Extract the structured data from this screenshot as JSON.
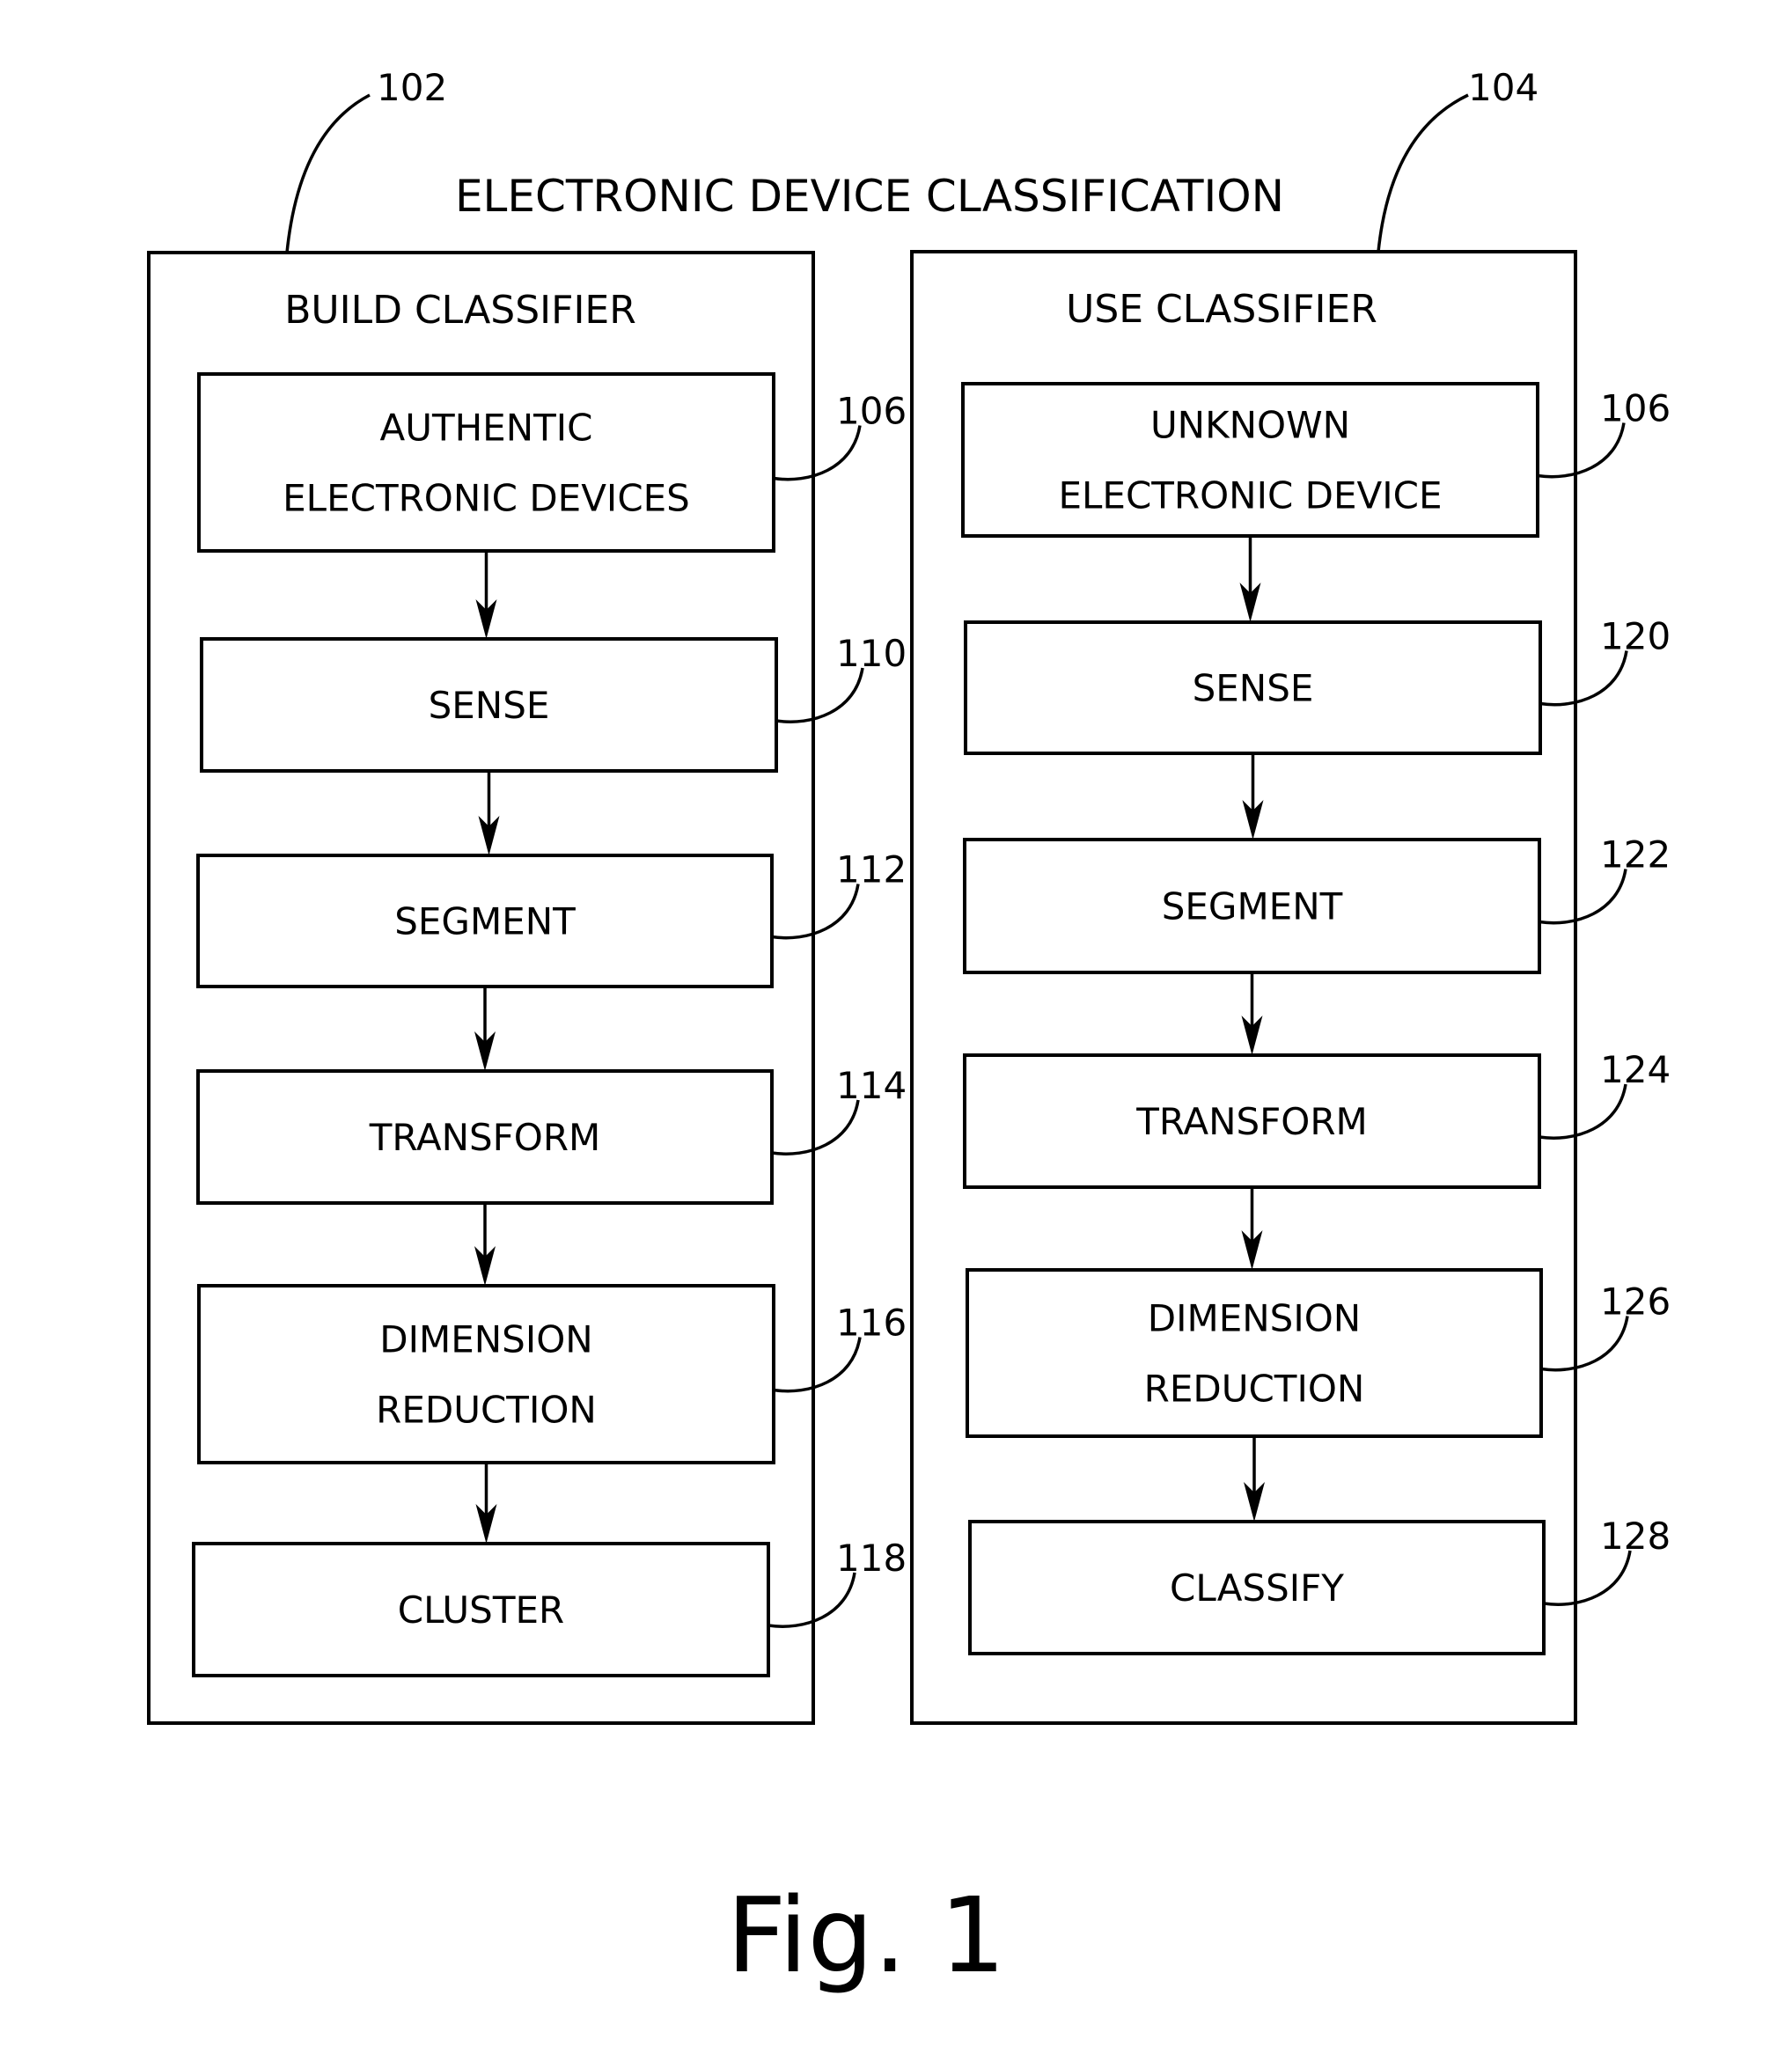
{
  "diagram": {
    "title": "ELECTRONIC DEVICE CLASSIFICATION",
    "figure_label": "Fig. 1",
    "panels": [
      {
        "id": "build",
        "ref": "102",
        "title": "BUILD CLASSIFIER",
        "steps": [
          {
            "ref": "106",
            "lines": [
              "AUTHENTIC",
              "ELECTRONIC DEVICES"
            ]
          },
          {
            "ref": "110",
            "lines": [
              "SENSE"
            ]
          },
          {
            "ref": "112",
            "lines": [
              "SEGMENT"
            ]
          },
          {
            "ref": "114",
            "lines": [
              "TRANSFORM"
            ]
          },
          {
            "ref": "116",
            "lines": [
              "DIMENSION",
              "REDUCTION"
            ]
          },
          {
            "ref": "118",
            "lines": [
              "CLUSTER"
            ]
          }
        ]
      },
      {
        "id": "use",
        "ref": "104",
        "title": "USE CLASSIFIER",
        "steps": [
          {
            "ref": "106",
            "lines": [
              "UNKNOWN",
              "ELECTRONIC DEVICE"
            ]
          },
          {
            "ref": "120",
            "lines": [
              "SENSE"
            ]
          },
          {
            "ref": "122",
            "lines": [
              "SEGMENT"
            ]
          },
          {
            "ref": "124",
            "lines": [
              "TRANSFORM"
            ]
          },
          {
            "ref": "126",
            "lines": [
              "DIMENSION",
              "REDUCTION"
            ]
          },
          {
            "ref": "128",
            "lines": [
              "CLASSIFY"
            ]
          }
        ]
      }
    ]
  }
}
